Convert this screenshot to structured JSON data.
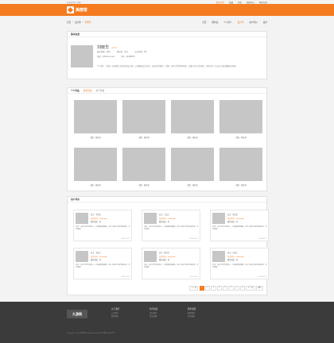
{
  "topbar": {
    "welcome": "欢迎来到九游网",
    "links": [
      "我的订单",
      "收藏",
      "消息",
      "帮助中心",
      "网站导航"
    ]
  },
  "header": {
    "logo_text": "美丽客"
  },
  "crumb": {
    "items": [
      "首页",
      "设计师",
      "刘晓华"
    ]
  },
  "nav": {
    "items": [
      "首页",
      "晒作品",
      "个人简介",
      "设计师",
      "用户评价",
      "发单"
    ]
  },
  "profile": {
    "heading": "基本信息",
    "name": "刘晓华",
    "badge": "★ 5.0",
    "line1": [
      "擅长领域：室内",
      "所在地：北京",
      "从业年限：5年"
    ],
    "line2": [
      "电话：188-xxxx-xxxx",
      "QQ：12345678"
    ],
    "desc": "个人简介：我是一名热爱生活的室内设计师，从事家装设计多年，擅长现代简约、北欧、新中式等多种风格。注重与业主的沟通，力求为每一位业主打造温馨舒适的家。"
  },
  "works": {
    "heading": "个人作品",
    "tab_on": "最新作品",
    "tab_off": "热门作品",
    "items": [
      "北欧 · 两居室",
      "北欧 · 两居室",
      "北欧 · 两居室",
      "北欧 · 两居室",
      "北欧 · 两居室",
      "北欧 · 两居室",
      "北欧 · 两居室",
      "北欧 · 两居室"
    ]
  },
  "reviews": {
    "heading": "用户评价",
    "items": [
      {
        "user": "业主：李先生",
        "score": "综合评分：★★★★★",
        "service": "服务态度：好",
        "text": "评论：设计师非常有耐心，方案做得很细致，施工过程中也经常来现场，非常满意！",
        "date": "2016-10-12"
      },
      {
        "user": "业主：王女士",
        "score": "综合评分：★★★★★",
        "service": "服务态度：好",
        "text": "评论：设计师非常有耐心，方案做得很细致，施工过程中也经常来现场，非常满意！",
        "date": "2016-10-12"
      },
      {
        "user": "业主：张先生",
        "score": "综合评分：★★★★★",
        "service": "服务态度：好",
        "text": "评论：设计师非常有耐心，方案做得很细致，施工过程中也经常来现场，非常满意！",
        "date": "2016-10-12"
      },
      {
        "user": "业主：赵女士",
        "score": "综合评分：★★★★★",
        "service": "服务态度：好",
        "text": "评论：设计师非常有耐心，方案做得很细致，施工过程中也经常来现场，非常满意！",
        "date": "2016-10-12"
      },
      {
        "user": "业主：陈先生",
        "score": "综合评分：★★★★★",
        "service": "服务态度：好",
        "text": "评论：设计师非常有耐心，方案做得很细致，施工过程中也经常来现场，非常满意！",
        "date": "2016-10-12"
      },
      {
        "user": "业主：刘女士",
        "score": "综合评分：★★★★★",
        "service": "服务态度：好",
        "text": "评论：设计师非常有耐心，方案做得很细致，施工过程中也经常来现场，非常满意！",
        "date": "2016-10-12"
      }
    ],
    "pager": [
      "上一页",
      "1",
      "2",
      "3",
      "4",
      "5",
      "6",
      "7",
      "8",
      "下一页",
      "跳转"
    ]
  },
  "footer": {
    "logo": "九游网",
    "cols": [
      {
        "h": "关于我们",
        "a": "公司简介",
        "b": "联系我们"
      },
      {
        "h": "新手指南",
        "a": "如何发单",
        "b": "常见问题"
      },
      {
        "h": "服务保障",
        "a": "质量保证",
        "b": "售后服务"
      }
    ],
    "copy": "Copyright © 2016 九游网 All Rights Reserved. 京ICP备12345678号"
  },
  "colors": {
    "accent": "#f47b20",
    "footer_bg": "#3b3b3b"
  }
}
